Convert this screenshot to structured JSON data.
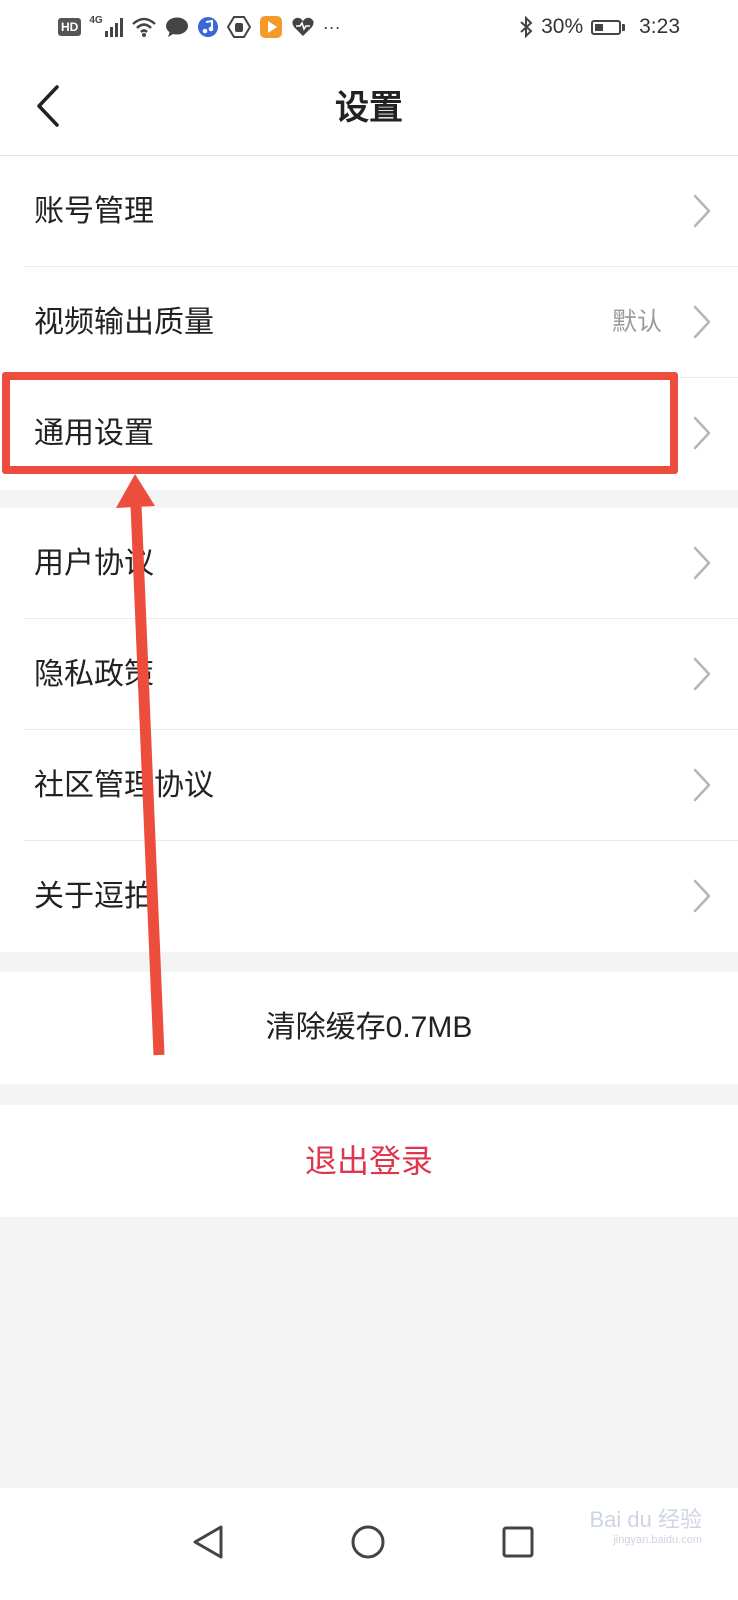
{
  "status_bar": {
    "network_badge": "HD",
    "network_type": "4G",
    "battery": "30%",
    "time": "3:23",
    "more": "···"
  },
  "header": {
    "title": "设置"
  },
  "settings_group_1": [
    {
      "label": "账号管理",
      "value": ""
    },
    {
      "label": "视频输出质量",
      "value": "默认"
    },
    {
      "label": "通用设置",
      "value": ""
    }
  ],
  "settings_group_2": [
    {
      "label": "用户协议"
    },
    {
      "label": "隐私政策"
    },
    {
      "label": "社区管理协议"
    },
    {
      "label": "关于逗拍"
    }
  ],
  "actions": {
    "clear_cache": "清除缓存0.7MB",
    "logout": "退出登录"
  },
  "watermark": {
    "text": "Bai du 经验",
    "sub": "jingyan.baidu.com"
  },
  "colors": {
    "logout": "#e0364c",
    "annotation": "#ec4d3c"
  }
}
